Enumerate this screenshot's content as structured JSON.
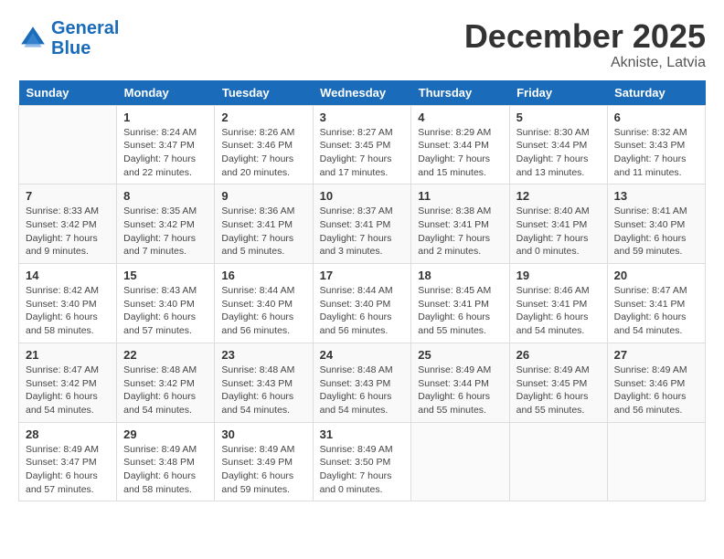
{
  "header": {
    "logo_line1": "General",
    "logo_line2": "Blue",
    "month": "December 2025",
    "location": "Akniste, Latvia"
  },
  "days_of_week": [
    "Sunday",
    "Monday",
    "Tuesday",
    "Wednesday",
    "Thursday",
    "Friday",
    "Saturday"
  ],
  "weeks": [
    [
      {
        "day": "",
        "sunrise": "",
        "sunset": "",
        "daylight": ""
      },
      {
        "day": "1",
        "sunrise": "Sunrise: 8:24 AM",
        "sunset": "Sunset: 3:47 PM",
        "daylight": "Daylight: 7 hours and 22 minutes."
      },
      {
        "day": "2",
        "sunrise": "Sunrise: 8:26 AM",
        "sunset": "Sunset: 3:46 PM",
        "daylight": "Daylight: 7 hours and 20 minutes."
      },
      {
        "day": "3",
        "sunrise": "Sunrise: 8:27 AM",
        "sunset": "Sunset: 3:45 PM",
        "daylight": "Daylight: 7 hours and 17 minutes."
      },
      {
        "day": "4",
        "sunrise": "Sunrise: 8:29 AM",
        "sunset": "Sunset: 3:44 PM",
        "daylight": "Daylight: 7 hours and 15 minutes."
      },
      {
        "day": "5",
        "sunrise": "Sunrise: 8:30 AM",
        "sunset": "Sunset: 3:44 PM",
        "daylight": "Daylight: 7 hours and 13 minutes."
      },
      {
        "day": "6",
        "sunrise": "Sunrise: 8:32 AM",
        "sunset": "Sunset: 3:43 PM",
        "daylight": "Daylight: 7 hours and 11 minutes."
      }
    ],
    [
      {
        "day": "7",
        "sunrise": "Sunrise: 8:33 AM",
        "sunset": "Sunset: 3:42 PM",
        "daylight": "Daylight: 7 hours and 9 minutes."
      },
      {
        "day": "8",
        "sunrise": "Sunrise: 8:35 AM",
        "sunset": "Sunset: 3:42 PM",
        "daylight": "Daylight: 7 hours and 7 minutes."
      },
      {
        "day": "9",
        "sunrise": "Sunrise: 8:36 AM",
        "sunset": "Sunset: 3:41 PM",
        "daylight": "Daylight: 7 hours and 5 minutes."
      },
      {
        "day": "10",
        "sunrise": "Sunrise: 8:37 AM",
        "sunset": "Sunset: 3:41 PM",
        "daylight": "Daylight: 7 hours and 3 minutes."
      },
      {
        "day": "11",
        "sunrise": "Sunrise: 8:38 AM",
        "sunset": "Sunset: 3:41 PM",
        "daylight": "Daylight: 7 hours and 2 minutes."
      },
      {
        "day": "12",
        "sunrise": "Sunrise: 8:40 AM",
        "sunset": "Sunset: 3:41 PM",
        "daylight": "Daylight: 7 hours and 0 minutes."
      },
      {
        "day": "13",
        "sunrise": "Sunrise: 8:41 AM",
        "sunset": "Sunset: 3:40 PM",
        "daylight": "Daylight: 6 hours and 59 minutes."
      }
    ],
    [
      {
        "day": "14",
        "sunrise": "Sunrise: 8:42 AM",
        "sunset": "Sunset: 3:40 PM",
        "daylight": "Daylight: 6 hours and 58 minutes."
      },
      {
        "day": "15",
        "sunrise": "Sunrise: 8:43 AM",
        "sunset": "Sunset: 3:40 PM",
        "daylight": "Daylight: 6 hours and 57 minutes."
      },
      {
        "day": "16",
        "sunrise": "Sunrise: 8:44 AM",
        "sunset": "Sunset: 3:40 PM",
        "daylight": "Daylight: 6 hours and 56 minutes."
      },
      {
        "day": "17",
        "sunrise": "Sunrise: 8:44 AM",
        "sunset": "Sunset: 3:40 PM",
        "daylight": "Daylight: 6 hours and 56 minutes."
      },
      {
        "day": "18",
        "sunrise": "Sunrise: 8:45 AM",
        "sunset": "Sunset: 3:41 PM",
        "daylight": "Daylight: 6 hours and 55 minutes."
      },
      {
        "day": "19",
        "sunrise": "Sunrise: 8:46 AM",
        "sunset": "Sunset: 3:41 PM",
        "daylight": "Daylight: 6 hours and 54 minutes."
      },
      {
        "day": "20",
        "sunrise": "Sunrise: 8:47 AM",
        "sunset": "Sunset: 3:41 PM",
        "daylight": "Daylight: 6 hours and 54 minutes."
      }
    ],
    [
      {
        "day": "21",
        "sunrise": "Sunrise: 8:47 AM",
        "sunset": "Sunset: 3:42 PM",
        "daylight": "Daylight: 6 hours and 54 minutes."
      },
      {
        "day": "22",
        "sunrise": "Sunrise: 8:48 AM",
        "sunset": "Sunset: 3:42 PM",
        "daylight": "Daylight: 6 hours and 54 minutes."
      },
      {
        "day": "23",
        "sunrise": "Sunrise: 8:48 AM",
        "sunset": "Sunset: 3:43 PM",
        "daylight": "Daylight: 6 hours and 54 minutes."
      },
      {
        "day": "24",
        "sunrise": "Sunrise: 8:48 AM",
        "sunset": "Sunset: 3:43 PM",
        "daylight": "Daylight: 6 hours and 54 minutes."
      },
      {
        "day": "25",
        "sunrise": "Sunrise: 8:49 AM",
        "sunset": "Sunset: 3:44 PM",
        "daylight": "Daylight: 6 hours and 55 minutes."
      },
      {
        "day": "26",
        "sunrise": "Sunrise: 8:49 AM",
        "sunset": "Sunset: 3:45 PM",
        "daylight": "Daylight: 6 hours and 55 minutes."
      },
      {
        "day": "27",
        "sunrise": "Sunrise: 8:49 AM",
        "sunset": "Sunset: 3:46 PM",
        "daylight": "Daylight: 6 hours and 56 minutes."
      }
    ],
    [
      {
        "day": "28",
        "sunrise": "Sunrise: 8:49 AM",
        "sunset": "Sunset: 3:47 PM",
        "daylight": "Daylight: 6 hours and 57 minutes."
      },
      {
        "day": "29",
        "sunrise": "Sunrise: 8:49 AM",
        "sunset": "Sunset: 3:48 PM",
        "daylight": "Daylight: 6 hours and 58 minutes."
      },
      {
        "day": "30",
        "sunrise": "Sunrise: 8:49 AM",
        "sunset": "Sunset: 3:49 PM",
        "daylight": "Daylight: 6 hours and 59 minutes."
      },
      {
        "day": "31",
        "sunrise": "Sunrise: 8:49 AM",
        "sunset": "Sunset: 3:50 PM",
        "daylight": "Daylight: 7 hours and 0 minutes."
      },
      {
        "day": "",
        "sunrise": "",
        "sunset": "",
        "daylight": ""
      },
      {
        "day": "",
        "sunrise": "",
        "sunset": "",
        "daylight": ""
      },
      {
        "day": "",
        "sunrise": "",
        "sunset": "",
        "daylight": ""
      }
    ]
  ]
}
